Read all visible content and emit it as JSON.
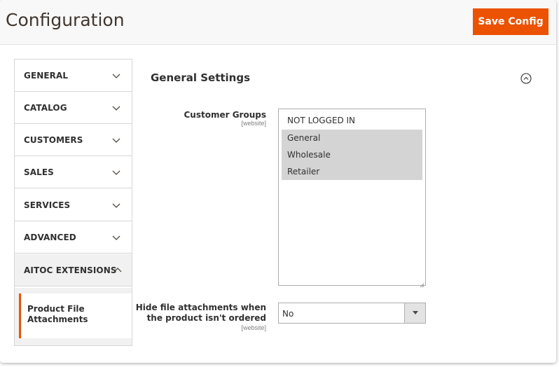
{
  "header": {
    "title": "Configuration",
    "save_label": "Save Config"
  },
  "sidebar": {
    "items": [
      {
        "label": "GENERAL",
        "icon": "chevron-down-icon"
      },
      {
        "label": "CATALOG",
        "icon": "chevron-down-icon"
      },
      {
        "label": "CUSTOMERS",
        "icon": "chevron-down-icon"
      },
      {
        "label": "SALES",
        "icon": "chevron-down-icon"
      },
      {
        "label": "SERVICES",
        "icon": "chevron-down-icon"
      },
      {
        "label": "ADVANCED",
        "icon": "chevron-down-icon"
      },
      {
        "label": "AITOC EXTENSIONS",
        "icon": "chevron-up-icon"
      }
    ],
    "sub_items": [
      {
        "label": "Product File Attachments",
        "active": true
      }
    ]
  },
  "main": {
    "section_title": "General Settings",
    "collapse_icon": "collapse-up-circle-icon",
    "customer_groups": {
      "label": "Customer Groups",
      "scope": "[website]",
      "options": [
        {
          "label": "NOT LOGGED IN",
          "selected": false
        },
        {
          "label": "General",
          "selected": true
        },
        {
          "label": "Wholesale",
          "selected": true
        },
        {
          "label": "Retailer",
          "selected": true
        }
      ]
    },
    "hide_attachments": {
      "label_line1": "Hide file attachments when",
      "label_line2": "the product isn't ordered",
      "scope": "[website]",
      "value": "No"
    }
  },
  "colors": {
    "accent": "#eb5202",
    "selected_option_bg": "#d4d4d4"
  }
}
